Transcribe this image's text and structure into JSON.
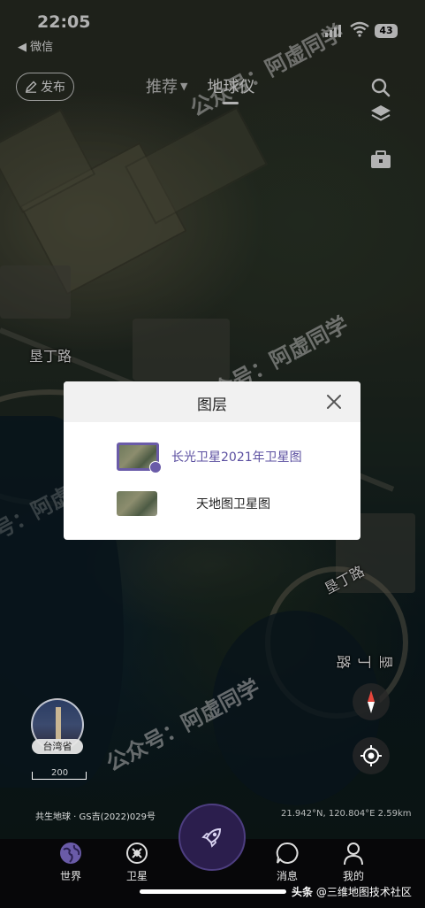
{
  "status_bar": {
    "time": "22:05",
    "back_app": "微信",
    "battery": "43"
  },
  "header": {
    "publish_label": "发布",
    "tabs": [
      {
        "label": "推荐"
      },
      {
        "label": "地球仪"
      }
    ]
  },
  "map": {
    "place_labels": [
      "垦丁路",
      "垦丁路",
      "垦丁路"
    ],
    "watermarks": [
      "公众号：阿虚同学",
      "公众号：阿虚同学",
      "公众号：阿虚同学",
      "公众号：阿虚同学"
    ],
    "region_label": "台湾省",
    "scale_value": "200",
    "copyright": "共生地球 · GS吉(2022)029号",
    "coords": "21.942°N, 120.804°E 2.59km"
  },
  "dialog": {
    "title": "图层",
    "layers": [
      {
        "label": "长光卫星2021年卫星图",
        "selected": true
      },
      {
        "label": "天地图卫星图",
        "selected": false
      }
    ]
  },
  "bottom_nav": {
    "items": [
      {
        "label": "世界"
      },
      {
        "label": "卫星"
      },
      {
        "label": "消息"
      },
      {
        "label": "我的"
      }
    ]
  },
  "source_credit": {
    "platform": "头条",
    "author": "@三维地图技术社区"
  },
  "colors": {
    "accent": "#6a5ba8",
    "selected_text": "#5b4fa0",
    "nav_bg": "#070709"
  }
}
